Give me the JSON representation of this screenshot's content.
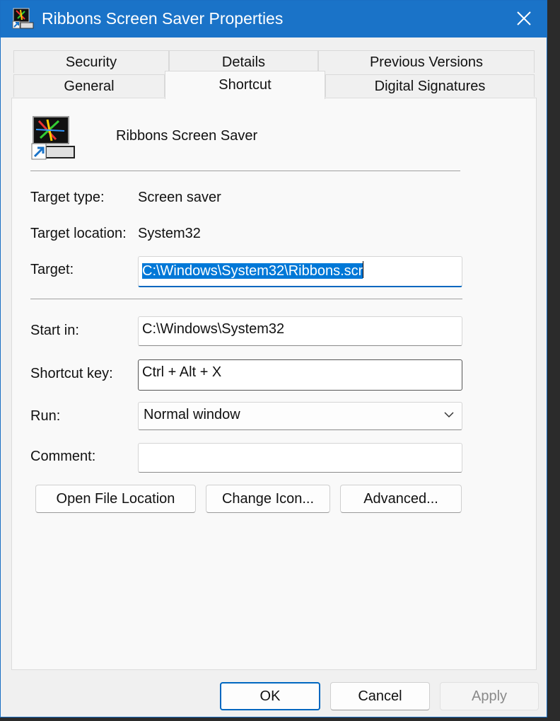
{
  "window": {
    "title": "Ribbons Screen Saver Properties",
    "close_icon": "close-icon",
    "app_icon": "screen-saver-shortcut-icon",
    "accent_color": "#1a73c8"
  },
  "tabs": {
    "row1": [
      "Security",
      "Details",
      "Previous Versions"
    ],
    "row2": [
      "General",
      "Shortcut",
      "Digital Signatures"
    ],
    "active": "Shortcut"
  },
  "shortcut": {
    "name": "Ribbons Screen Saver",
    "target_type_label": "Target type:",
    "target_type_value": "Screen saver",
    "target_location_label": "Target location:",
    "target_location_value": "System32",
    "target_label": "Target:",
    "target_value": "C:\\Windows\\System32\\Ribbons.scr",
    "start_in_label": "Start in:",
    "start_in_value": "C:\\Windows\\System32",
    "shortcut_key_label": "Shortcut key:",
    "shortcut_key_value": "Ctrl + Alt + X",
    "run_label": "Run:",
    "run_value": "Normal window",
    "comment_label": "Comment:",
    "comment_value": ""
  },
  "actions": {
    "open_file_location": "Open File Location",
    "change_icon": "Change Icon...",
    "advanced": "Advanced..."
  },
  "footer": {
    "ok": "OK",
    "cancel": "Cancel",
    "apply": "Apply"
  }
}
